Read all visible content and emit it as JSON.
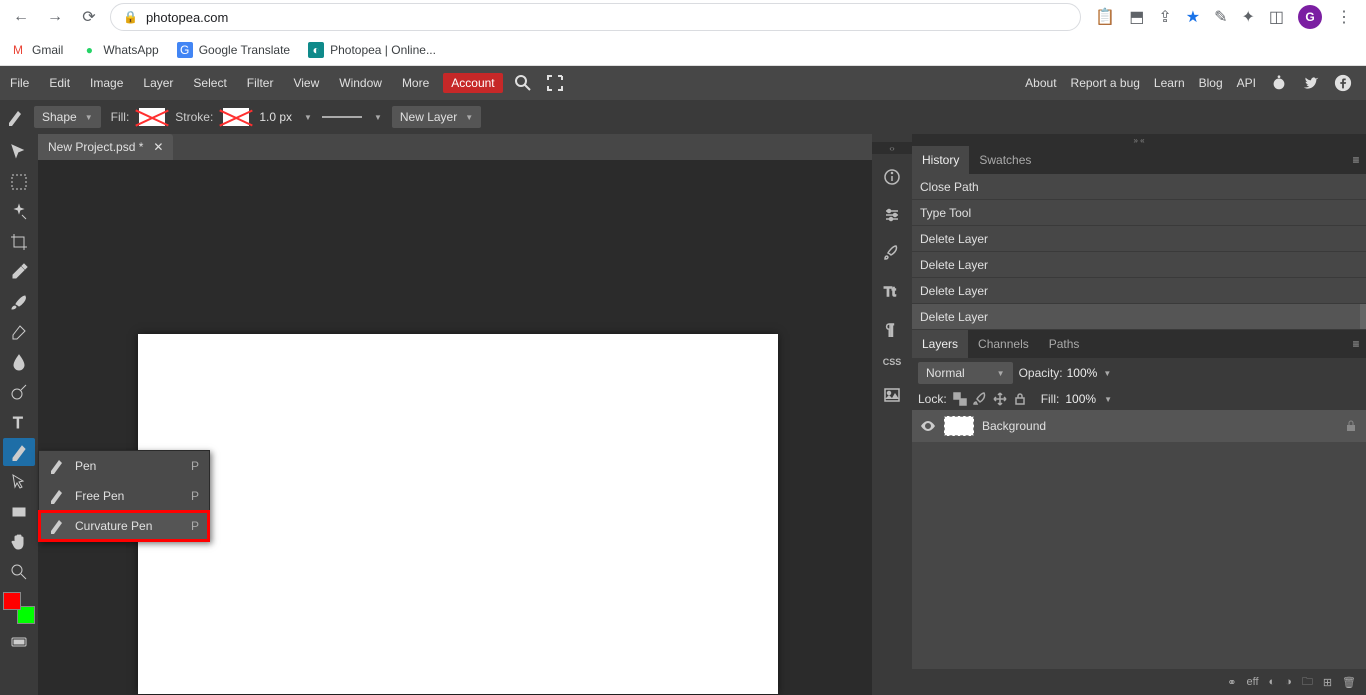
{
  "browser": {
    "url_host": "photopea.com",
    "avatar_letter": "G"
  },
  "bookmarks": {
    "gmail": "Gmail",
    "whatsapp": "WhatsApp",
    "gtranslate": "Google Translate",
    "photopea": "Photopea | Online..."
  },
  "menubar": {
    "file": "File",
    "edit": "Edit",
    "image": "Image",
    "layer": "Layer",
    "select": "Select",
    "filter": "Filter",
    "view": "View",
    "window": "Window",
    "more": "More",
    "account": "Account"
  },
  "menubar_right": {
    "about": "About",
    "report": "Report a bug",
    "learn": "Learn",
    "blog": "Blog",
    "api": "API"
  },
  "optbar": {
    "mode": "Shape",
    "fill_label": "Fill:",
    "stroke_label": "Stroke:",
    "stroke_width": "1.0 px",
    "new_layer": "New Layer"
  },
  "doctab": {
    "name": "New Project.psd *"
  },
  "flyout": {
    "pen": "Pen",
    "free_pen": "Free Pen",
    "curvature_pen": "Curvature Pen",
    "shortcut": "P"
  },
  "panels": {
    "history_tab": "History",
    "swatches_tab": "Swatches",
    "layers_tab": "Layers",
    "channels_tab": "Channels",
    "paths_tab": "Paths"
  },
  "history": {
    "items": [
      "Close Path",
      "Type Tool",
      "Delete Layer",
      "Delete Layer",
      "Delete Layer",
      "Delete Layer"
    ]
  },
  "layers_panel": {
    "blend_mode": "Normal",
    "opacity_label": "Opacity:",
    "opacity_val": "100%",
    "lock_label": "Lock:",
    "fill_label": "Fill:",
    "fill_val": "100%",
    "layer_name": "Background"
  },
  "rtabs": {
    "css": "CSS"
  },
  "layer_footer": {
    "eff": "eff"
  }
}
